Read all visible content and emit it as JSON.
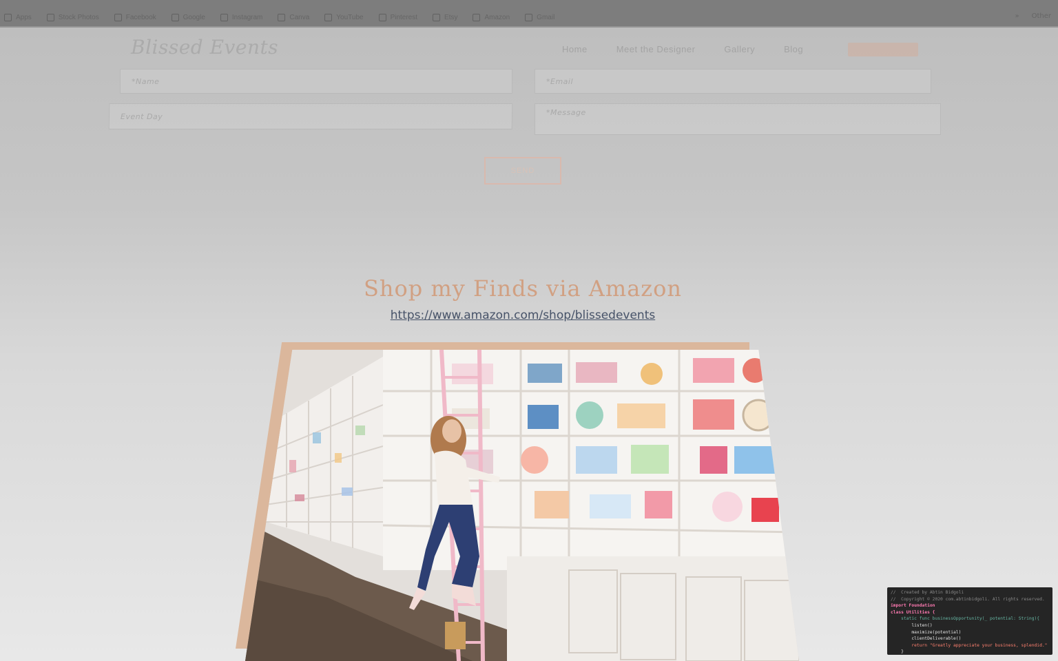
{
  "bookmarks": [
    "Apps",
    "Stock Photos",
    "Facebook",
    "Google",
    "Instagram",
    "Canva",
    "YouTube",
    "Pinterest",
    "Etsy",
    "Amazon",
    "Gmail"
  ],
  "bookmarks_right": [
    "»",
    "Other"
  ],
  "site": {
    "logo": "Blissed Events",
    "nav": [
      "Home",
      "Meet the Designer",
      "Gallery",
      "Blog"
    ]
  },
  "form": {
    "name_placeholder": "*Name",
    "email_placeholder": "*Email",
    "event_day_placeholder": "Event Day",
    "message_placeholder": "*Message",
    "send_label": "SEND"
  },
  "shop": {
    "title": "Shop my Finds via Amazon",
    "link": "https://www.amazon.com/shop/blissedevents"
  },
  "code": {
    "lines": [
      {
        "cls": "c-comment",
        "text": "//  Created by Abtin Bidgoli"
      },
      {
        "cls": "c-comment",
        "text": "//  Copyright © 2020 com.abtinbidgoli. All rights reserved."
      },
      {
        "cls": "c-kw",
        "text": "import Foundation"
      },
      {
        "cls": "c-kw",
        "text": "class Utilities {"
      },
      {
        "cls": "c-fn",
        "text": "    static func businessOpportunity(_ potential: String){"
      },
      {
        "cls": "c-plain",
        "text": "        listen()"
      },
      {
        "cls": "c-plain",
        "text": "        maximize(potential)"
      },
      {
        "cls": "c-plain",
        "text": "        clientDeliverable()"
      },
      {
        "cls": "c-str",
        "text": "        return \"Greatly appreciate your business, splendid.\""
      },
      {
        "cls": "c-plain",
        "text": "    }"
      }
    ]
  },
  "colors": {
    "accent": "#d1a082",
    "frame": "#dbb79c",
    "link": "#465268"
  }
}
